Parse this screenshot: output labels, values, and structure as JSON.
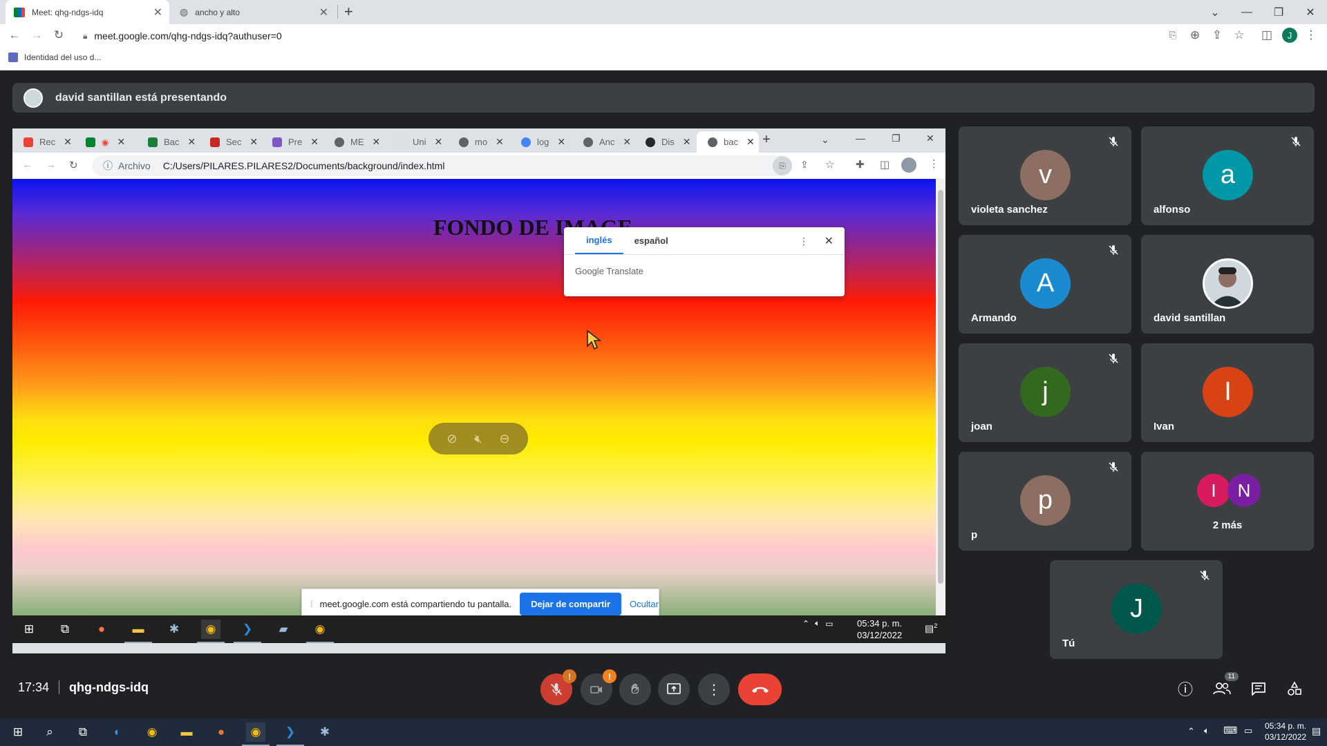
{
  "outer_browser": {
    "tabs": [
      {
        "title": "Meet: qhg-ndgs-idq",
        "active": true
      },
      {
        "title": "ancho y alto",
        "active": false
      }
    ],
    "url": "meet.google.com/qhg-ndgs-idq?authuser=0",
    "profile_initial": "J",
    "bookmark": "Identidad del uso d..."
  },
  "presenter_banner": {
    "text": "david santillan está presentando"
  },
  "shared_screen": {
    "tabs": [
      "Rec",
      "",
      "Bac",
      "Sec",
      "Pre",
      "ME",
      "Uni",
      "mo",
      "log",
      "Anc",
      "Dis",
      "bac"
    ],
    "address_prefix": "Archivo",
    "address": "C:/Users/PILARES.PILARES2/Documents/background/index.html",
    "page_heading": "FONDO DE IMAGE",
    "translate_popup": {
      "lang_from": "inglés",
      "lang_to": "español",
      "brand_google": "Google",
      "brand_translate": "Translate"
    },
    "share_notice": {
      "text": "meet.google.com está compartiendo tu pantalla.",
      "stop_button": "Dejar de compartir",
      "hide_link": "Ocultar"
    },
    "taskbar_time": "05:34 p. m.",
    "taskbar_date": "03/12/2022",
    "taskbar_notif_count": "2"
  },
  "participants": [
    {
      "name": "violeta sanchez",
      "initial": "v",
      "color": "#8d6e63",
      "muted": true
    },
    {
      "name": "alfonso",
      "initial": "a",
      "color": "#0097a7",
      "muted": true
    },
    {
      "name": "Armando",
      "initial": "A",
      "color": "#1a8bd0",
      "muted": true
    },
    {
      "name": "david santillan",
      "initial": "",
      "color": "#cfd8dc",
      "muted": false
    },
    {
      "name": "joan",
      "initial": "j",
      "color": "#33691e",
      "muted": true
    },
    {
      "name": "Ivan",
      "initial": "I",
      "color": "#d84315",
      "muted": false
    },
    {
      "name": "p",
      "initial": "p",
      "color": "#8d6e63",
      "muted": true
    }
  ],
  "more_tile": {
    "label": "2 más",
    "initials": [
      "I",
      "N"
    ],
    "colors": [
      "#d81b60",
      "#7b1fa2"
    ]
  },
  "self_tile": {
    "name": "Tú",
    "initial": "J",
    "color": "#00574b",
    "muted": true
  },
  "meet_bar": {
    "time": "17:34",
    "meeting_code": "qhg-ndgs-idq",
    "people_count": "11"
  },
  "host_taskbar": {
    "time": "05:34 p. m.",
    "date": "03/12/2022"
  }
}
